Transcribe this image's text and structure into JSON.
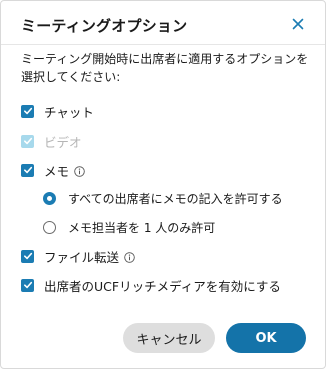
{
  "dialog": {
    "title": "ミーティングオプション",
    "description": "ミーティング開始時に出席者に適用するオプションを選択してください:",
    "close_icon": "close-icon"
  },
  "options": {
    "chat": {
      "label": "チャット",
      "checked": true,
      "disabled": false
    },
    "video": {
      "label": "ビデオ",
      "checked": true,
      "disabled": true
    },
    "memo": {
      "label": "メモ",
      "checked": true,
      "disabled": false,
      "info_icon": "info-icon",
      "sub_options": [
        {
          "label": "すべての出席者にメモの記入を許可する",
          "selected": true
        },
        {
          "label": "メモ担当者を 1 人のみ許可",
          "selected": false
        }
      ]
    },
    "file_transfer": {
      "label": "ファイル転送",
      "checked": true,
      "disabled": false,
      "info_icon": "info-icon"
    },
    "ucf_rich_media": {
      "label": "出席者のUCFリッチメディアを有効にする",
      "checked": true,
      "disabled": false
    }
  },
  "buttons": {
    "cancel_label": "キャンセル",
    "ok_label": "OK"
  },
  "colors": {
    "accent": "#1b7cb3",
    "accent_disabled": "#a7d9ec",
    "ok_button": "#1473a9",
    "cancel_button": "#dedede"
  }
}
